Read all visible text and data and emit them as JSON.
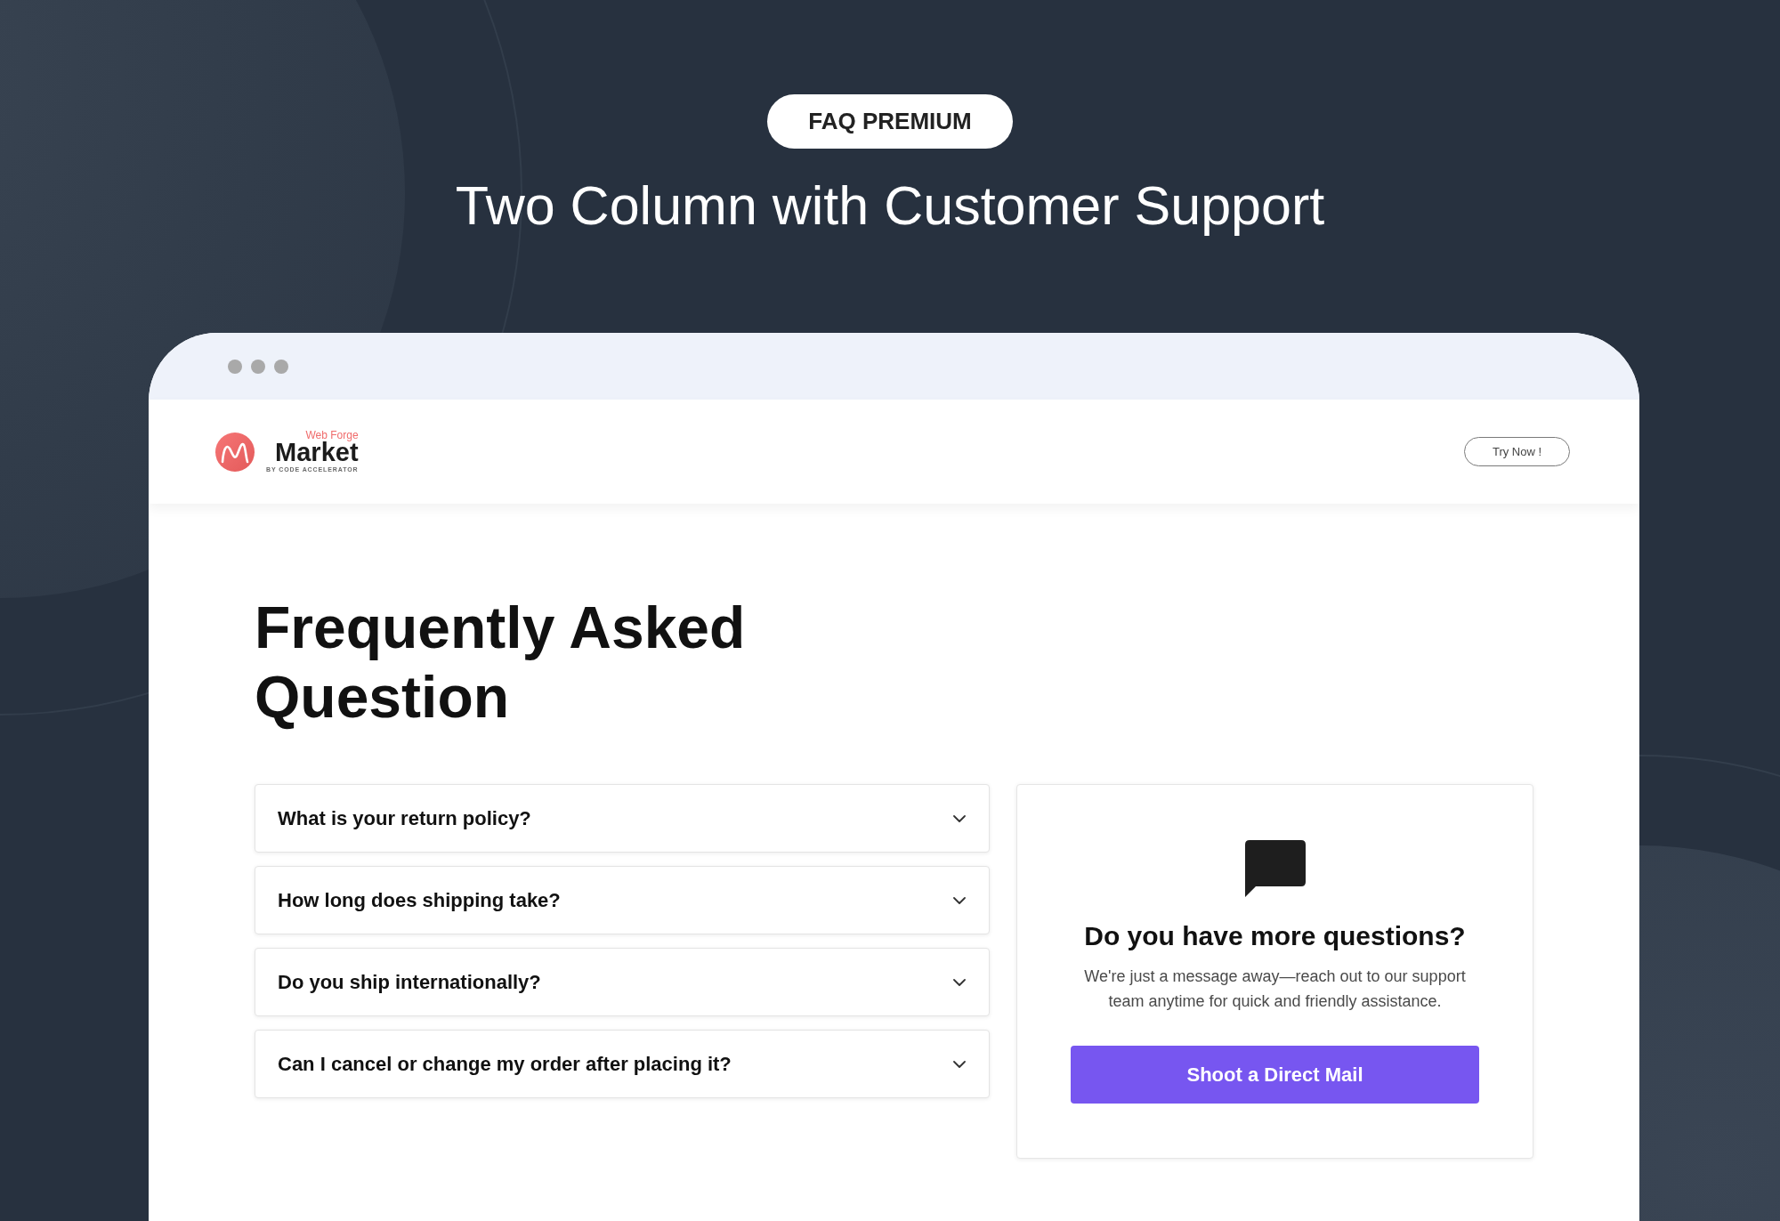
{
  "badge": "FAQ PREMIUM",
  "headline": "Two Column with Customer Support",
  "browser": {
    "navbar": {
      "logo": {
        "tagline": "Web Forge",
        "name": "Market",
        "subtitle": "BY CODE ACCELERATOR"
      },
      "cta": "Try Now !"
    },
    "faq": {
      "title": "Frequently Asked Question",
      "items": [
        {
          "question": "What is your return policy?",
          "expanded": false
        },
        {
          "question": "How long does shipping take?",
          "expanded": false
        },
        {
          "question": "Do you ship internationally?",
          "expanded": false
        },
        {
          "question": "Can I cancel or change my order after placing it?",
          "expanded": false
        }
      ]
    },
    "support_card": {
      "title": "Do you have more questions?",
      "text": "We're just a message away—reach out to our support team anytime for quick and friendly assistance.",
      "button": "Shoot a Direct Mail"
    }
  }
}
